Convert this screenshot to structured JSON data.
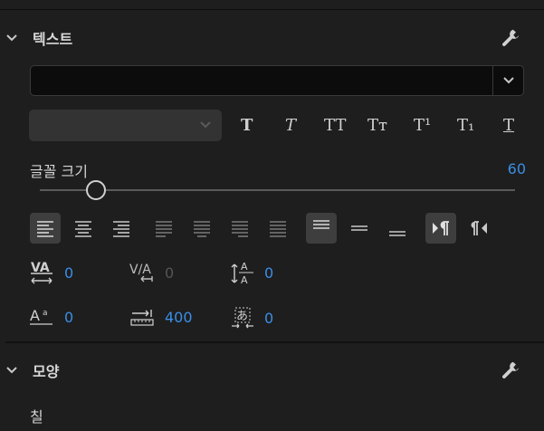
{
  "text_section": {
    "title": "텍스트",
    "font_family_value": "",
    "font_style_value": "",
    "text_styles": [
      "T",
      "T",
      "TT",
      "Tт",
      "T¹",
      "T₁",
      "T"
    ],
    "font_size_label": "글꼴 크기",
    "font_size_value": "60",
    "font_size_min": 0,
    "font_size_max": 512,
    "metrics": {
      "kerning": "0",
      "tracking": "0",
      "leading": "0",
      "baseline_shift": "0",
      "tsume": "400",
      "indent": "0"
    }
  },
  "shape_section": {
    "title": "모양",
    "fill_label": "칠"
  },
  "colors": {
    "accent": "#3a8ee6",
    "panel_bg": "#1e1e1e"
  },
  "icons": [
    "chevron-down-icon",
    "wrench-icon",
    "align-left-icon",
    "align-center-icon",
    "align-right-icon",
    "justify-icon",
    "text-top-icon",
    "text-center-icon",
    "text-bottom-icon",
    "ltr-icon",
    "rtl-icon",
    "kerning-icon",
    "tracking-icon",
    "leading-icon",
    "baseline-shift-icon",
    "tsume-icon",
    "indent-icon"
  ]
}
